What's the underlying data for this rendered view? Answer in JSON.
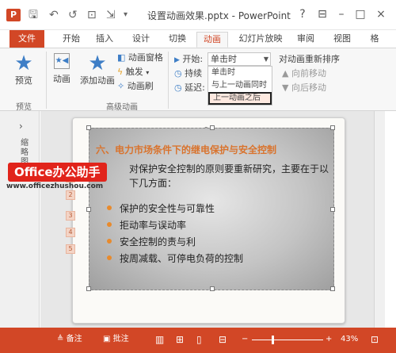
{
  "titlebar": {
    "app_icon": "P",
    "title": "设置动画效果.pptx - PowerPoint",
    "qat": [
      "save-icon",
      "undo-icon",
      "redo-icon",
      "start-from-beginning-icon",
      "customize-icon"
    ],
    "controls": [
      "?",
      "ribbon-display-icon",
      "–",
      "□",
      "×"
    ]
  },
  "tabs": [
    {
      "label": "文件"
    },
    {
      "label": "开始"
    },
    {
      "label": "插入"
    },
    {
      "label": "设计"
    },
    {
      "label": "切换"
    },
    {
      "label": "动画"
    },
    {
      "label": "幻灯片放映"
    },
    {
      "label": "审阅"
    },
    {
      "label": "视图"
    },
    {
      "label": "格"
    }
  ],
  "ribbon": {
    "preview": "预览",
    "animation": "动画",
    "add_animation": "添加动画",
    "animation_pane": "动画窗格",
    "trigger": "触发",
    "painter": "动画刷",
    "start_label": "开始:",
    "start_value": "单击时",
    "duration_label": "持续",
    "delay_label": "延迟:",
    "reorder": "对动画重新排序",
    "move_earlier": "向前移动",
    "move_later": "向后移动",
    "group_preview": "预览",
    "group_advanced": "高级动画",
    "dropdown_options": [
      "单击时",
      "与上一动画同时",
      "上一动画之后"
    ]
  },
  "leftpane": {
    "label": "缩略图"
  },
  "slide": {
    "title": "六、电力市场条件下的继电保护与安全控制",
    "intro": "对保护安全控制的原则要重新研究，主要在于以下几方面：",
    "bullets": [
      "保护的安全性与可靠性",
      "拒动率与误动率",
      "安全控制的责与利",
      "按周减载、可停电负荷的控制"
    ],
    "anim_tags": [
      "1",
      "2",
      "3",
      "4",
      "5"
    ]
  },
  "watermark": {
    "badge": "Office办公助手",
    "url": "www.officezhushou.com"
  },
  "statusbar": {
    "notes": "备注",
    "comments": "批注",
    "zoom": "43%"
  }
}
